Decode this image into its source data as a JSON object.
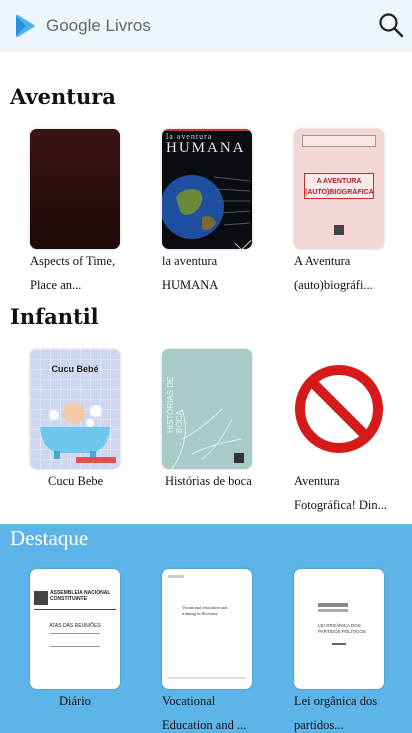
{
  "header": {
    "brand": "Google Livros",
    "logo_icon": "google-play-books-icon",
    "search_icon": "search-icon"
  },
  "sections": [
    {
      "title": "Aventura",
      "books": [
        {
          "caption1": "Aspects of Time,",
          "caption2": "Place an..."
        },
        {
          "caption1": "la aventura",
          "caption2": "HUMANA"
        },
        {
          "caption1": "A Aventura",
          "caption2": "(auto)biográfi..."
        }
      ]
    },
    {
      "title": "Infantil",
      "books": [
        {
          "caption1": "Cucu Bebe",
          "caption2": ""
        },
        {
          "caption1": "Histórias de boca",
          "caption2": ""
        },
        {
          "caption1": "Aventura",
          "caption2": "Fotográfica! Din..."
        }
      ]
    }
  ],
  "featured": {
    "title": "Destaque",
    "books": [
      {
        "caption1": "Diário",
        "caption2": ""
      },
      {
        "caption1": "Vocational",
        "caption2": "Education and ..."
      },
      {
        "caption1": "Lei orgânica dos",
        "caption2": "partidos..."
      }
    ]
  },
  "covers": {
    "humana_title": "HUMANA",
    "humana_top": "la aventura",
    "autobio_title": "A AVENTURA (AUTO)BIOGRÁFICA",
    "cucu_title": "Cucu Bebé",
    "historias_title": "HISTÓRIAS DE BOCA",
    "diario_title": "ASSEMBLEIA NACIONAL CONSTITUINTE",
    "diario_sub": "ATAS DAS REUNIÕES",
    "vocational_text": "Vocational education and training in Slovenia",
    "lei_text": "LEI ORGÂNICA DOS PARTIDOS POLÍTICOS"
  },
  "colors": {
    "header_bg": "#eef6fc",
    "featured_bg": "#5db4e8",
    "no_symbol": "#d41a1a"
  }
}
